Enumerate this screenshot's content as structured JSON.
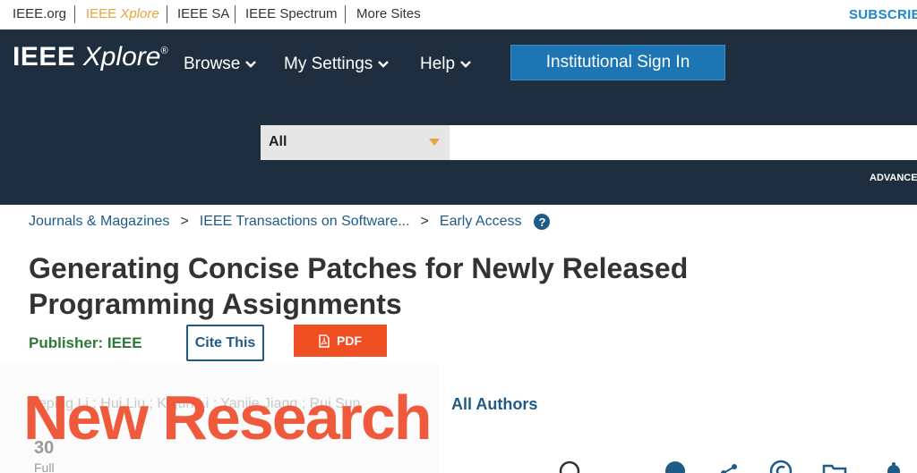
{
  "topbar": {
    "links": [
      {
        "label": "IEEE.org"
      },
      {
        "label_a": "IEEE ",
        "label_b": "Xplore"
      },
      {
        "label": "IEEE SA"
      },
      {
        "label": "IEEE Spectrum"
      },
      {
        "label": "More Sites"
      }
    ],
    "subscribe_label": "SUBSCRIBE"
  },
  "header": {
    "logo": {
      "brand": "IEEE",
      "product": "Xplore",
      "mark": "®"
    },
    "nav": [
      {
        "label": "Browse",
        "icon": "chevron-down-icon"
      },
      {
        "label": "My Settings",
        "icon": "chevron-down-icon"
      },
      {
        "label": "Help",
        "icon": "chevron-down-icon"
      }
    ],
    "signin_label": "Institutional Sign In",
    "search": {
      "scope_value": "All",
      "placeholder": ""
    },
    "advanced_label": "ADVANCED"
  },
  "breadcrumb": [
    {
      "label": "Journals & Magazines"
    },
    {
      "label": "IEEE Transactions on Software..."
    },
    {
      "label": "Early Access"
    }
  ],
  "article": {
    "title": "Generating Concise Patches for Newly Released Programming Assignments",
    "publisher_label": "Publisher:",
    "publisher_name": "IEEE",
    "cite_label": "Cite This",
    "pdf_label": "PDF",
    "authors_partial": "Leping Li ; Hui Liu ; Kejun Li ; Yanjie Jiang ; Rui Sun",
    "all_authors_label": "All Authors",
    "cites_count": "30",
    "cites_label": "Full"
  },
  "overlay": {
    "text": "New Research",
    "color": "#f05a3c"
  },
  "colors": {
    "header_bg": "#1e2e3e",
    "accent": "#e8a33d",
    "link": "#1f5b87",
    "signin_bg": "#1d75b3",
    "pdf_bg": "#f04e23",
    "publisher": "#2b7a37"
  },
  "icons": [
    "chevron-down-icon",
    "help-icon",
    "pdf-icon",
    "search-icon",
    "share-icon",
    "copyright-icon",
    "folder-icon",
    "bell-icon"
  ]
}
